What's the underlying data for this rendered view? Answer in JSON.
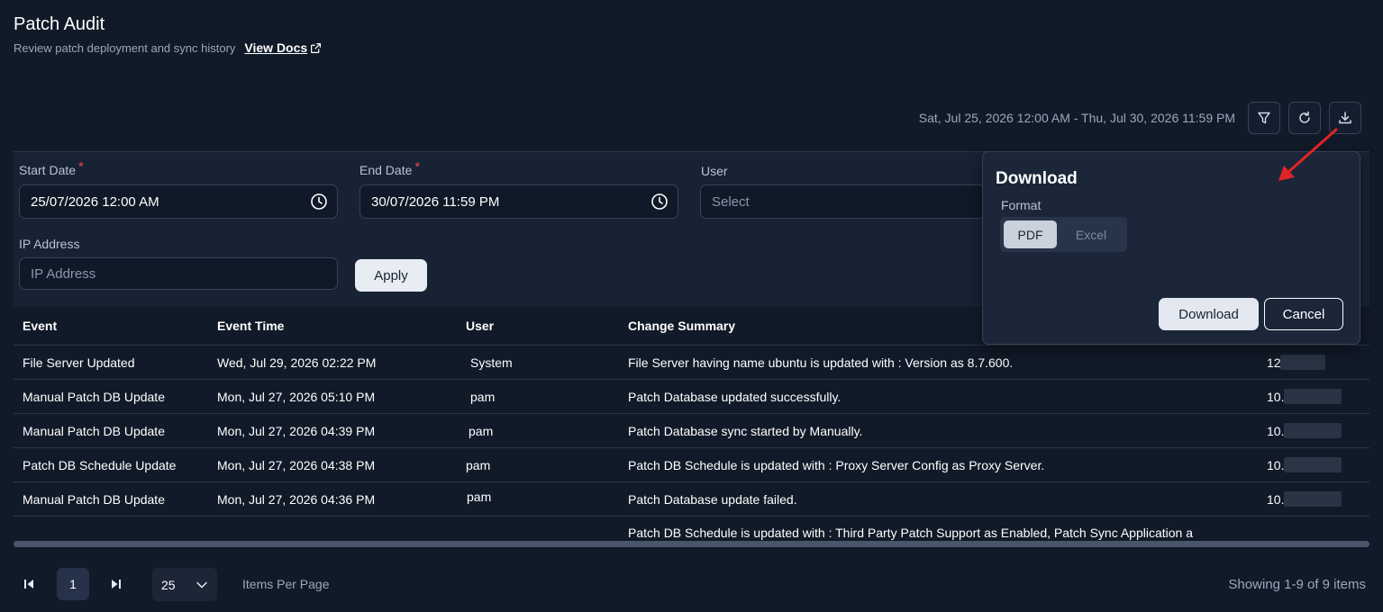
{
  "header": {
    "title": "Patch Audit",
    "subtitle": "Review patch deployment and sync history",
    "docs_link": "View Docs"
  },
  "toolbar": {
    "date_range": "Sat, Jul 25, 2026 12:00 AM - Thu, Jul 30, 2026 11:59 PM",
    "icons": [
      "filter-icon",
      "refresh-icon",
      "download-icon"
    ]
  },
  "filters": {
    "start_date": {
      "label": "Start Date",
      "required_mark": "*",
      "value": "25/07/2026 12:00 AM"
    },
    "end_date": {
      "label": "End Date",
      "required_mark": "*",
      "value": "30/07/2026 11:59 PM"
    },
    "user": {
      "label": "User",
      "placeholder": "Select"
    },
    "ip_address": {
      "label": "IP Address",
      "placeholder": "IP Address"
    },
    "apply_label": "Apply"
  },
  "table": {
    "columns": [
      "Event",
      "Event Time",
      "User",
      "Change Summary"
    ],
    "rows": [
      {
        "event": "File Server Updated",
        "time": "Wed, Jul 29, 2026 02:22 PM",
        "user": "System",
        "summary": "File Server having name ubuntu is updated with : Version as 8.7.600.",
        "ip": "12."
      },
      {
        "event": "Manual Patch DB Update",
        "time": "Mon, Jul 27, 2026 05:10 PM",
        "user": "pam",
        "summary": "Patch Database updated successfully.",
        "ip": "10."
      },
      {
        "event": "Manual Patch DB Update",
        "time": "Mon, Jul 27, 2026 04:39 PM",
        "user": "pam",
        "summary": "Patch Database sync started by Manually.",
        "ip": "10."
      },
      {
        "event": "Patch DB Schedule Update",
        "time": "Mon, Jul 27, 2026 04:38 PM",
        "user": "pam",
        "summary": "Patch DB Schedule is updated with : Proxy Server Config as Proxy Server.",
        "ip": "10."
      },
      {
        "event": "Manual Patch DB Update",
        "time": "Mon, Jul 27, 2026 04:36 PM",
        "user": "pam",
        "summary": "Patch Database update failed.",
        "ip": "10."
      },
      {
        "event": "",
        "time": "",
        "user": "",
        "summary": "Patch DB Schedule is updated with : Third Party Patch Support as Enabled, Patch Sync Application a",
        "ip": ""
      }
    ]
  },
  "pagination": {
    "current_page": "1",
    "page_size": "25",
    "items_per_page_label": "Items Per Page",
    "showing": "Showing 1-9 of 9 items"
  },
  "download_popover": {
    "title": "Download",
    "format_label": "Format",
    "options": [
      "PDF",
      "Excel"
    ],
    "selected": "PDF",
    "download_label": "Download",
    "cancel_label": "Cancel"
  },
  "colors": {
    "background": "#111a28",
    "panel": "#172233",
    "popover": "#1b2638",
    "required": "#e5484d",
    "annotation_arrow": "#e02424"
  }
}
